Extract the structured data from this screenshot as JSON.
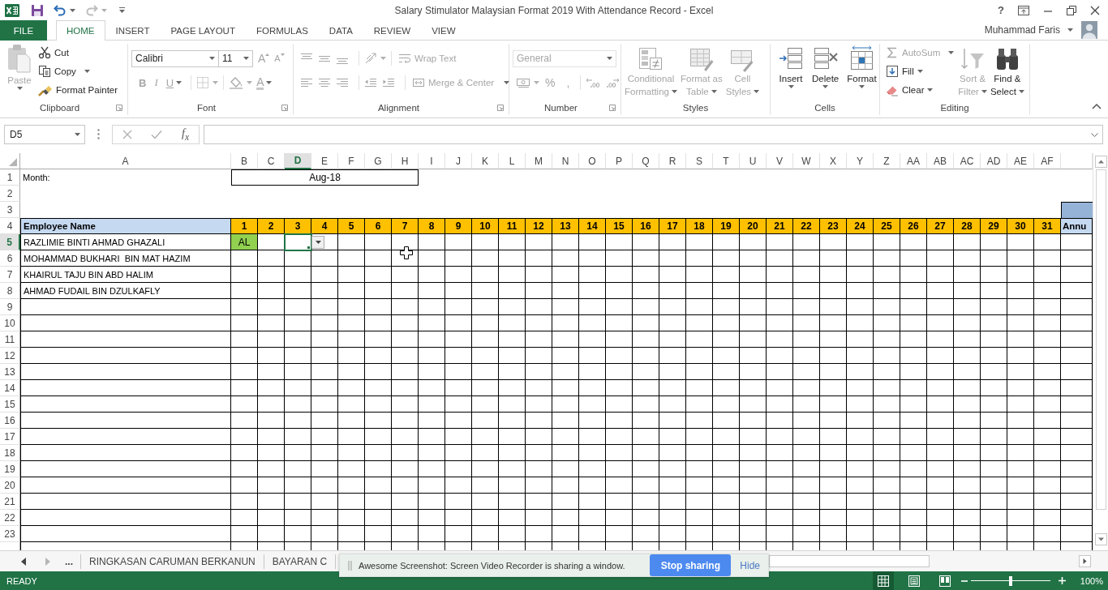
{
  "title_bar": {
    "title": "Salary Stimulator Malaysian Format 2019 With Attendance Record - Excel",
    "help": "?"
  },
  "ribbon_tabs": [
    {
      "label": "FILE",
      "kind": "file",
      "selected": false
    },
    {
      "label": "HOME",
      "kind": "tab",
      "selected": true
    },
    {
      "label": "INSERT",
      "kind": "tab",
      "selected": false
    },
    {
      "label": "PAGE LAYOUT",
      "kind": "tab",
      "selected": false
    },
    {
      "label": "FORMULAS",
      "kind": "tab",
      "selected": false
    },
    {
      "label": "DATA",
      "kind": "tab",
      "selected": false
    },
    {
      "label": "REVIEW",
      "kind": "tab",
      "selected": false
    },
    {
      "label": "VIEW",
      "kind": "tab",
      "selected": false
    }
  ],
  "account": {
    "name": "Muhammad Faris"
  },
  "ribbon": {
    "clipboard": {
      "label": "Clipboard",
      "paste": {
        "label": "Paste",
        "disabled": true
      },
      "cut": {
        "label": "Cut",
        "disabled": false
      },
      "copy": {
        "label": "Copy",
        "disabled": false
      },
      "format_painter": {
        "label": "Format Painter",
        "disabled": false
      }
    },
    "font": {
      "label": "Font",
      "font_name": {
        "value": "Calibri"
      },
      "font_size": {
        "value": "11"
      },
      "size_buttons": [
        {
          "label": "A",
          "kind": "grow",
          "disabled": true
        },
        {
          "label": "A",
          "kind": "shrink",
          "disabled": true
        }
      ],
      "style_buttons": [
        {
          "label": "B",
          "kind": "bold",
          "disabled": true
        },
        {
          "label": "I",
          "kind": "italic",
          "disabled": true
        },
        {
          "label": "U",
          "kind": "underline",
          "disabled": true
        }
      ],
      "font_color": {
        "label": "A",
        "disabled": true
      }
    },
    "alignment": {
      "label": "Alignment",
      "wrap_text": {
        "label": "Wrap Text",
        "disabled": true
      },
      "merge": {
        "label": "Merge & Center",
        "disabled": true
      }
    },
    "number": {
      "label": "Number",
      "format": {
        "value": "General",
        "disabled": true
      },
      "percent": {
        "label": "%",
        "disabled": true
      },
      "comma": {
        "label": ",",
        "disabled": true
      }
    },
    "styles": {
      "label": "Styles",
      "buttons": [
        {
          "lines": [
            "Conditional",
            "Formatting"
          ],
          "disabled": true
        },
        {
          "lines": [
            "Format as",
            "Table"
          ],
          "disabled": true
        },
        {
          "lines": [
            "Cell",
            "Styles"
          ],
          "disabled": true
        }
      ]
    },
    "cells": {
      "label": "Cells",
      "buttons": [
        {
          "label": "Insert",
          "disabled": false
        },
        {
          "label": "Delete",
          "disabled": false
        },
        {
          "label": "Format",
          "disabled": false
        }
      ]
    },
    "editing": {
      "label": "Editing",
      "small": [
        {
          "label": "AutoSum",
          "disabled": true
        },
        {
          "label": "Fill",
          "disabled": false
        },
        {
          "label": "Clear",
          "disabled": false
        }
      ],
      "large": [
        {
          "lines": [
            "Sort &",
            "Filter"
          ],
          "disabled": true
        },
        {
          "lines": [
            "Find &",
            "Select"
          ],
          "disabled": false
        }
      ]
    }
  },
  "formula_bar": {
    "name_box": "D5",
    "function_label": "f$_{x}$"
  },
  "sheet": {
    "columns": [
      {
        "label": "A",
        "selected": false
      },
      {
        "label": "B",
        "selected": false
      },
      {
        "label": "C",
        "selected": false
      },
      {
        "label": "D",
        "selected": true
      },
      {
        "label": "E",
        "selected": false
      },
      {
        "label": "F",
        "selected": false
      },
      {
        "label": "G",
        "selected": false
      },
      {
        "label": "H",
        "selected": false
      },
      {
        "label": "I",
        "selected": false
      },
      {
        "label": "J",
        "selected": false
      },
      {
        "label": "K",
        "selected": false
      },
      {
        "label": "L",
        "selected": false
      },
      {
        "label": "M",
        "selected": false
      },
      {
        "label": "N",
        "selected": false
      },
      {
        "label": "O",
        "selected": false
      },
      {
        "label": "P",
        "selected": false
      },
      {
        "label": "Q",
        "selected": false
      },
      {
        "label": "R",
        "selected": false
      },
      {
        "label": "S",
        "selected": false
      },
      {
        "label": "T",
        "selected": false
      },
      {
        "label": "U",
        "selected": false
      },
      {
        "label": "V",
        "selected": false
      },
      {
        "label": "W",
        "selected": false
      },
      {
        "label": "X",
        "selected": false
      },
      {
        "label": "Y",
        "selected": false
      },
      {
        "label": "Z",
        "selected": false
      },
      {
        "label": "AA",
        "selected": false
      },
      {
        "label": "AB",
        "selected": false
      },
      {
        "label": "AC",
        "selected": false
      },
      {
        "label": "AD",
        "selected": false
      },
      {
        "label": "AE",
        "selected": false
      },
      {
        "label": "AF",
        "selected": false
      }
    ],
    "rows": [
      {
        "label": "1",
        "selected": false,
        "kind": "month",
        "name": "Month:",
        "value": "Aug-18"
      },
      {
        "label": "2",
        "selected": false,
        "kind": "blank"
      },
      {
        "label": "3",
        "selected": false,
        "kind": "band"
      },
      {
        "label": "4",
        "selected": false,
        "kind": "header",
        "name": "Employee Name",
        "days": [
          "1",
          "2",
          "3",
          "4",
          "5",
          "6",
          "7",
          "8",
          "9",
          "10",
          "11",
          "12",
          "13",
          "14",
          "15",
          "16",
          "17",
          "18",
          "19",
          "20",
          "21",
          "22",
          "23",
          "24",
          "25",
          "26",
          "27",
          "28",
          "29",
          "30",
          "31"
        ],
        "extra": "Annu"
      },
      {
        "label": "5",
        "selected": true,
        "kind": "employee",
        "name": "RAZLIMIE BINTI AHMAD GHAZALI",
        "days": [
          "AL"
        ]
      },
      {
        "label": "6",
        "selected": false,
        "kind": "employee",
        "name": "MOHAMMAD BUKHARI  BIN MAT HAZIM"
      },
      {
        "label": "7",
        "selected": false,
        "kind": "employee",
        "name": "KHAIRUL TAJU BIN ABD HALIM"
      },
      {
        "label": "8",
        "selected": false,
        "kind": "employee",
        "name": "AHMAD FUDAIL BIN DZULKAFLY"
      },
      {
        "label": "9",
        "selected": false,
        "kind": "employee"
      },
      {
        "label": "10",
        "selected": false,
        "kind": "employee"
      },
      {
        "label": "11",
        "selected": false,
        "kind": "employee"
      },
      {
        "label": "12",
        "selected": false,
        "kind": "employee"
      },
      {
        "label": "13",
        "selected": false,
        "kind": "employee"
      },
      {
        "label": "14",
        "selected": false,
        "kind": "employee"
      },
      {
        "label": "15",
        "selected": false,
        "kind": "employee"
      },
      {
        "label": "16",
        "selected": false,
        "kind": "employee"
      },
      {
        "label": "17",
        "selected": false,
        "kind": "employee"
      },
      {
        "label": "18",
        "selected": false,
        "kind": "employee"
      },
      {
        "label": "19",
        "selected": false,
        "kind": "employee"
      },
      {
        "label": "20",
        "selected": false,
        "kind": "employee"
      },
      {
        "label": "21",
        "selected": false,
        "kind": "employee"
      },
      {
        "label": "22",
        "selected": false,
        "kind": "employee"
      },
      {
        "label": "23",
        "selected": false,
        "kind": "employee"
      }
    ],
    "validation_dropdown": true
  },
  "sheet_tabs": {
    "overflow": "...",
    "tabs": [
      {
        "label": "RINGKASAN CARUMAN BERKANUN",
        "selected": false
      },
      {
        "label": "BAYARAN C",
        "selected": false
      }
    ]
  },
  "share_bar": {
    "message": "Awesome Screenshot: Screen Video Recorder is sharing a window.",
    "stop_button": "Stop sharing",
    "hide_link": "Hide"
  },
  "status_bar": {
    "status": "READY",
    "views": [
      {
        "kind": "normal",
        "selected": true
      },
      {
        "kind": "page_layout",
        "selected": false
      },
      {
        "kind": "page_break",
        "selected": false
      }
    ],
    "zoom": {
      "level": 0.5,
      "reading": "100%"
    }
  }
}
